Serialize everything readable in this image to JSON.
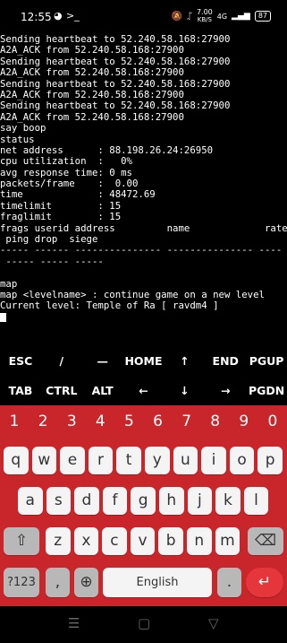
{
  "status_bar": {
    "time": "12:55",
    "app_icons": [
      "gamepad-icon",
      "terminal-icon"
    ],
    "net_speed_value": "7.00",
    "net_speed_unit": "KB/S",
    "network": "4G",
    "battery": "87"
  },
  "terminal": {
    "lines": [
      "Sending heartbeat to 52.240.58.168:27900",
      "A2A_ACK from 52.240.58.168:27900",
      "Sending heartbeat to 52.240.58.168:27900",
      "A2A_ACK from 52.240.58.168:27900",
      "Sending heartbeat to 52.240.58.168:27900",
      "A2A_ACK from 52.240.58.168:27900",
      "Sending heartbeat to 52.240.58.168:27900",
      "A2A_ACK from 52.240.58.168:27900",
      "say boop",
      "status",
      "net address      : 88.198.26.24:26950",
      "cpu utilization  :   0%",
      "avg response time: 0 ms",
      "packets/frame    :  0.00",
      "time             : 48472.69",
      "timelimit        : 15",
      "fraglimit        : 15",
      "frags userid address         name             rate",
      " ping drop  siege",
      "----- ------ --------------- --------------- ----",
      " ----- ----- -----",
      "",
      "map",
      "map <levelname> : continue game on a new level",
      "Current level: Temple of Ra [ ravdm4 ]"
    ]
  },
  "extra_keys": {
    "row1": [
      "ESC",
      "/",
      "—",
      "HOME",
      "↑",
      "END",
      "PGUP"
    ],
    "row2": [
      "TAB",
      "CTRL",
      "ALT",
      "←",
      "↓",
      "→",
      "PGDN"
    ]
  },
  "keyboard": {
    "numbers": [
      "1",
      "2",
      "3",
      "4",
      "5",
      "6",
      "7",
      "8",
      "9",
      "0"
    ],
    "row1": [
      "q",
      "w",
      "e",
      "r",
      "t",
      "y",
      "u",
      "i",
      "o",
      "p"
    ],
    "row2": [
      "a",
      "s",
      "d",
      "f",
      "g",
      "h",
      "j",
      "k",
      "l"
    ],
    "row3": [
      "z",
      "x",
      "c",
      "v",
      "b",
      "n",
      "m"
    ],
    "symbols_label": "?123",
    "comma": ",",
    "space_label": "English",
    "period": ".",
    "colors": {
      "keyboard_bg": "#c8262b",
      "enter_bg": "#e5373b"
    }
  },
  "nav_bar": {
    "icons": [
      "menu-icon",
      "home-icon",
      "back-icon"
    ]
  }
}
